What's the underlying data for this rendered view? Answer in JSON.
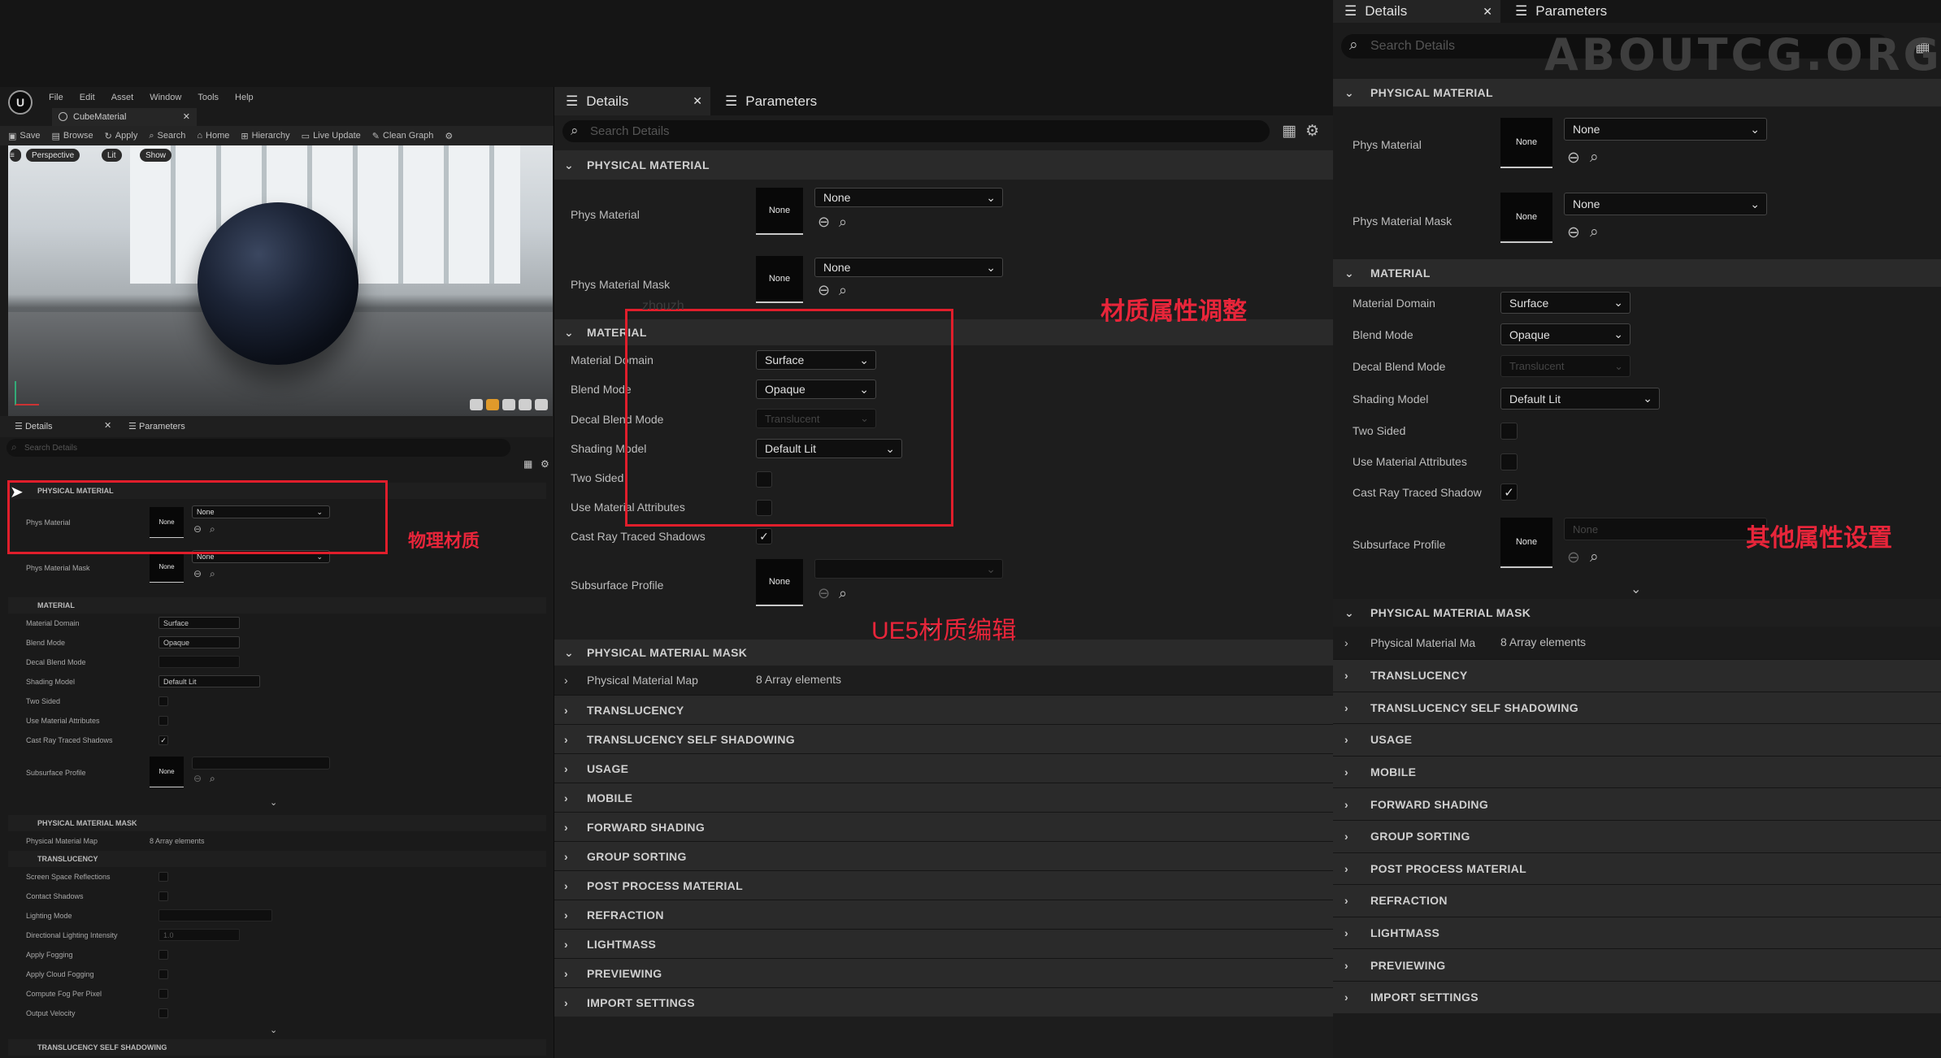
{
  "editor": {
    "menu": [
      "File",
      "Edit",
      "Asset",
      "Window",
      "Tools",
      "Help"
    ],
    "tab_title": "CubeMaterial",
    "toolbar": [
      "Save",
      "Browse",
      "Apply",
      "Search",
      "Home",
      "Hierarchy",
      "Live Update",
      "Clean Graph"
    ],
    "viewport": {
      "perspective": "Perspective",
      "lit": "Lit",
      "show": "Show"
    },
    "panel_tabs": [
      "Details",
      "Parameters"
    ],
    "search_placeholder": "Search Details",
    "sections": {
      "physical_material": "PHYSICAL MATERIAL",
      "material": "MATERIAL",
      "physical_material_mask": "PHYSICAL MATERIAL MASK",
      "translucency": "TRANSLUCENCY",
      "translucency_self_shadowing": "TRANSLUCENCY SELF SHADOWING"
    },
    "phys_material": "Phys Material",
    "phys_material_mask": "Phys Material Mask",
    "none": "None",
    "material_rows": [
      {
        "label": "Material Domain",
        "value": "Surface"
      },
      {
        "label": "Blend Mode",
        "value": "Opaque"
      },
      {
        "label": "Decal Blend Mode",
        "value": ""
      },
      {
        "label": "Shading Model",
        "value": "Default Lit"
      }
    ],
    "checkbox_rows": [
      {
        "label": "Two Sided",
        "checked": false
      },
      {
        "label": "Use Material Attributes",
        "checked": false
      },
      {
        "label": "Cast Ray Traced Shadows",
        "checked": true
      }
    ],
    "subsurface_profile": "Subsurface Profile",
    "physical_material_map": "Physical Material Map",
    "array_elements": "8 Array elements",
    "translucency_rows": [
      "Screen Space Reflections",
      "Contact Shadows",
      "Lighting Mode",
      "Directional Lighting Intensity",
      "Apply Fogging",
      "Apply Cloud Fogging",
      "Compute Fog Per Pixel",
      "Output Velocity"
    ],
    "directional_lighting_value": "1.0",
    "annotation": "物理材质"
  },
  "details": {
    "tabs": [
      "Details",
      "Parameters"
    ],
    "search_placeholder": "Search Details",
    "physical_material_header": "PHYSICAL MATERIAL",
    "phys_material": "Phys Material",
    "phys_material_mask": "Phys Material Mask",
    "none": "None",
    "material_header": "MATERIAL",
    "material_domain": {
      "label": "Material Domain",
      "value": "Surface"
    },
    "blend_mode": {
      "label": "Blend Mode",
      "value": "Opaque"
    },
    "decal_blend_mode": {
      "label": "Decal Blend Mode",
      "value": "Translucent"
    },
    "shading_model": {
      "label": "Shading Model",
      "value": "Default Lit"
    },
    "two_sided": "Two Sided",
    "use_material_attributes": "Use Material Attributes",
    "cast_ray_traced_shadows": "Cast Ray Traced Shadows",
    "subsurface_profile": "Subsurface Profile",
    "physical_material_mask_header": "PHYSICAL MATERIAL MASK",
    "physical_material_map": "Physical Material Map",
    "array_elements": "8 Array elements",
    "collapsed_sections": [
      "TRANSLUCENCY",
      "TRANSLUCENCY SELF SHADOWING",
      "USAGE",
      "MOBILE",
      "FORWARD SHADING",
      "GROUP SORTING",
      "POST PROCESS MATERIAL",
      "REFRACTION",
      "LIGHTMASS",
      "PREVIEWING",
      "IMPORT SETTINGS"
    ],
    "watermark_user": "zhouzh",
    "annotation_material": "材质属性调整",
    "annotation_ue5": "UE5材质编辑"
  },
  "zoom": {
    "tabs": [
      "Details",
      "Parameters"
    ],
    "search_placeholder": "Search Details",
    "physical_material_header": "PHYSICAL MATERIAL",
    "phys_material": "Phys Material",
    "phys_material_mask": "Phys Material Mask",
    "none": "None",
    "material_header": "MATERIAL",
    "material_domain": {
      "label": "Material Domain",
      "value": "Surface"
    },
    "blend_mode": {
      "label": "Blend Mode",
      "value": "Opaque"
    },
    "decal_blend_mode": {
      "label": "Decal Blend Mode",
      "value": "Translucent"
    },
    "shading_model": {
      "label": "Shading Model",
      "value": "Default Lit"
    },
    "two_sided": "Two Sided",
    "use_material_attributes": "Use Material Attributes",
    "cast_ray_traced_shadow": "Cast Ray Traced Shadow",
    "subsurface_profile": "Subsurface Profile",
    "physical_material_mask_header": "PHYSICAL MATERIAL MASK",
    "physical_material_map": "Physical Material Ma",
    "array_elements": "8 Array elements",
    "collapsed_sections": [
      "TRANSLUCENCY",
      "TRANSLUCENCY SELF SHADOWING",
      "USAGE",
      "MOBILE",
      "FORWARD SHADING",
      "GROUP SORTING",
      "POST PROCESS MATERIAL",
      "REFRACTION",
      "LIGHTMASS",
      "PREVIEWING",
      "IMPORT SETTINGS"
    ],
    "watermark": "ABOUTCG.ORG",
    "annotation_other": "其他属性设置"
  },
  "colors": {
    "annotation_red": "#e01e2b",
    "panel_bg": "#1d1d1d",
    "section_bg": "#2a2a2a"
  }
}
